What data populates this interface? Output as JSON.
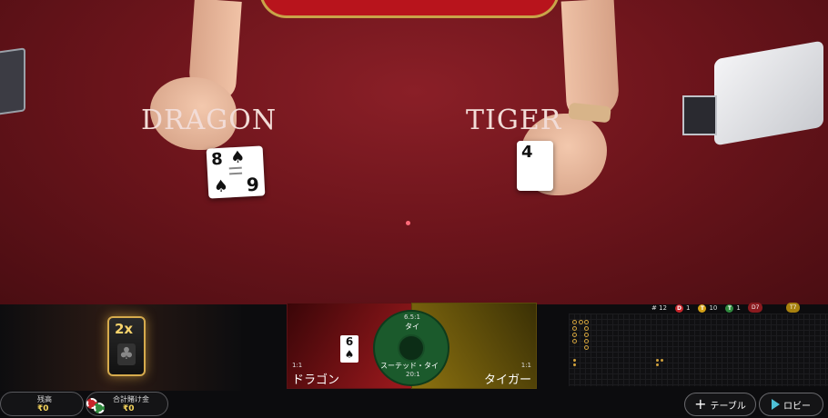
{
  "table": {
    "dragon_word": "DRAGON",
    "tiger_word": "TIGER",
    "dragon_card": {
      "rank": "8",
      "suit": "♠",
      "rank_bottom": "9"
    },
    "tiger_card": {
      "rank": "4"
    }
  },
  "multiplier": {
    "label": "2x",
    "suit": "♣"
  },
  "bet_spots": {
    "dragon": {
      "payout": "1:1",
      "label": "ドラゴン",
      "card_rank": "6",
      "card_suit": "♠"
    },
    "tie": {
      "payout_top": "6.5:1",
      "label_top": "タイ",
      "label_bottom": "スーテッド・タイ",
      "payout_bottom": "20:1"
    },
    "tiger": {
      "payout": "1:1",
      "label": "タイガー"
    }
  },
  "stats": {
    "round": "# 12",
    "dragon_count": "1",
    "dragon_letter": "D",
    "tiger_count": "10",
    "tiger_letter": "T",
    "tie_count": "1",
    "tie_letter": "T",
    "dragon_pill": "D7",
    "tiger_pill": "T7",
    "colors": {
      "dragon": "#c8242a",
      "tiger": "#d4a017",
      "tie": "#2f8a3e"
    }
  },
  "footer": {
    "balance_label": "残高",
    "balance_value": "₹0",
    "total_bet_label": "合計賭け金",
    "total_bet_value": "₹0"
  },
  "nav": {
    "table_label": "テーブル",
    "lobby_label": "ロビー",
    "table_icon": "plus-icon",
    "lobby_icon": "lobby-arrow-icon"
  }
}
